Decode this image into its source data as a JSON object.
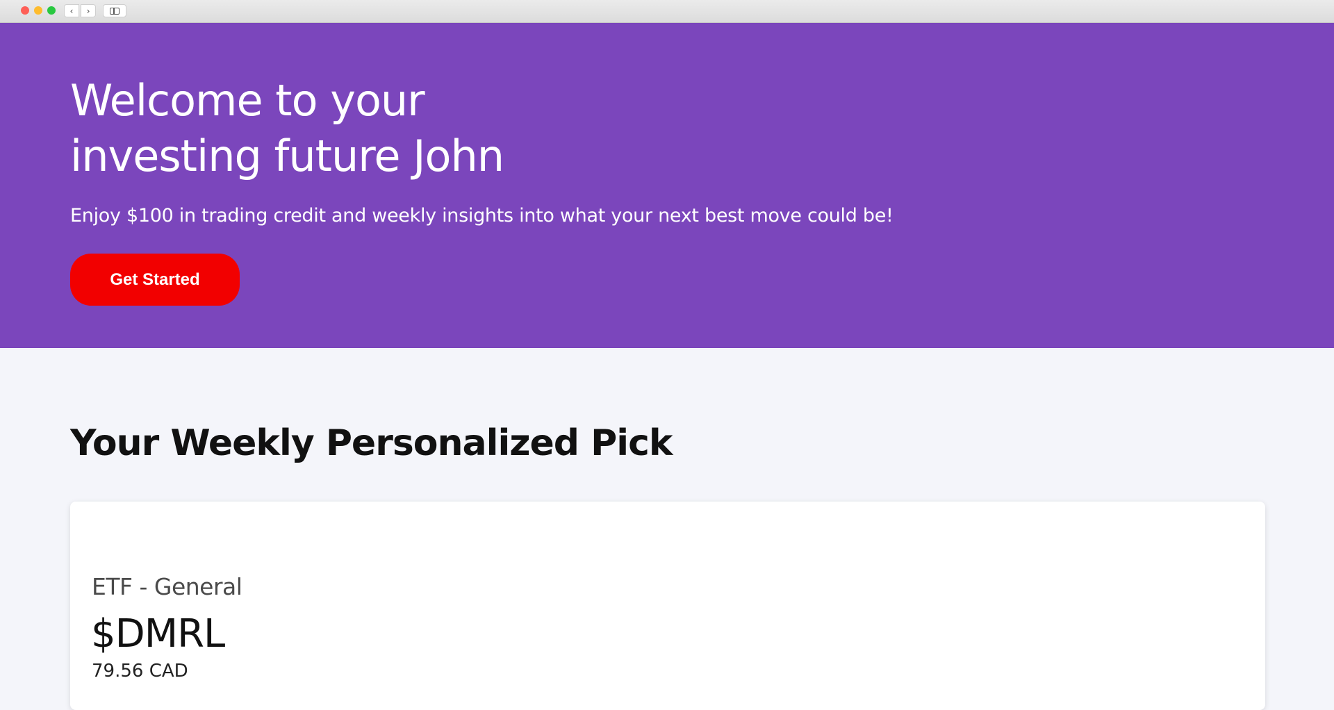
{
  "browser": {
    "back_icon": "chevron-left-icon",
    "forward_icon": "chevron-right-icon",
    "sidebar_icon": "sidebar-icon",
    "back_glyph": "‹",
    "forward_glyph": "›"
  },
  "hero": {
    "title_line1": "Welcome to your",
    "title_line2": "investing future John",
    "subtitle": "Enjoy $100 in trading credit and weekly insights into what your next best move could be!",
    "cta_label": "Get Started",
    "background_color": "#7b46bc",
    "cta_color": "#f20000"
  },
  "weekly_pick": {
    "section_title": "Your Weekly Personalized Pick",
    "category": "ETF - General",
    "ticker": "$DMRL",
    "price": "79.56 CAD"
  }
}
